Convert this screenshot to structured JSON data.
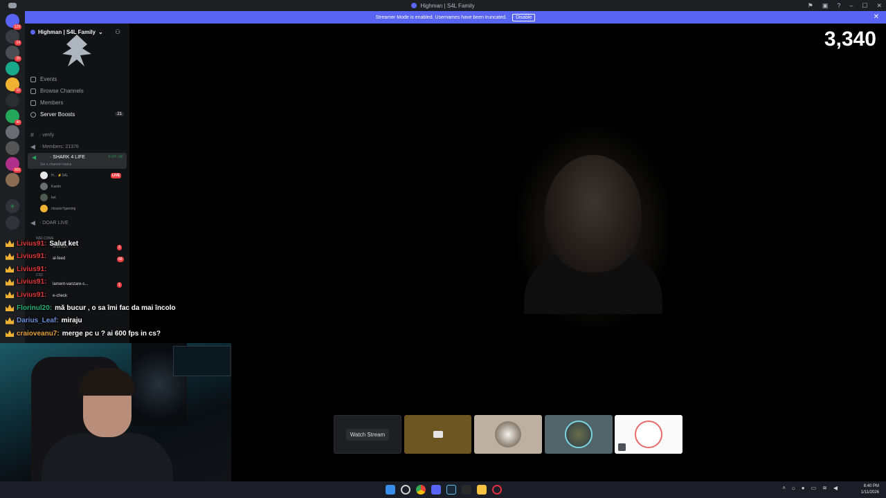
{
  "window": {
    "title": "Highman | S4L Family",
    "controls": [
      "–",
      "☐",
      "✕"
    ]
  },
  "banner": {
    "text": "Streamer Mode is enabled. Usernames have been truncated.",
    "disable_label": "Disable",
    "close_label": "✕"
  },
  "rail": {
    "servers": [
      {
        "name": "home",
        "color": "#5865f2",
        "badge": "129"
      },
      {
        "name": "server-1",
        "color": "#3a3c42",
        "badge": "14"
      },
      {
        "name": "server-2",
        "color": "#4a4d52",
        "badge": "26"
      },
      {
        "name": "server-3",
        "color": "#1aa88a",
        "badge": ""
      },
      {
        "name": "server-4",
        "color": "#f0b232",
        "badge": "10"
      },
      {
        "name": "server-5",
        "color": "#2b2d31",
        "badge": ""
      },
      {
        "name": "server-6",
        "color": "#23a55a",
        "badge": "40"
      },
      {
        "name": "server-7",
        "color": "#6a6d72",
        "badge": ""
      },
      {
        "name": "server-8",
        "color": "#555",
        "badge": ""
      },
      {
        "name": "server-9",
        "color": "#b02f8a",
        "badge": "365"
      },
      {
        "name": "server-10",
        "color": "#8a6d52",
        "badge": ""
      }
    ]
  },
  "sidebar": {
    "server_name": "Highman | S4L Family",
    "nav": [
      {
        "label": "Events",
        "count": ""
      },
      {
        "label": "Browse Channels",
        "count": ""
      },
      {
        "label": "Members",
        "count": ""
      },
      {
        "label": "Server Boosts",
        "count": "21"
      }
    ],
    "channels": [
      {
        "label": "· verify"
      },
      {
        "label": "· Members: 21376"
      }
    ],
    "voice": {
      "name": "· SHARK 4 LIFE",
      "status": "Set a channel status",
      "timer": "3:07:36",
      "live": "LIVE",
      "users": [
        "H... ⚡S4L",
        "Kasim",
        "ket",
        "nicusor7gaming"
      ]
    },
    "doar_live": "· DOAR LIVE",
    "category_welcome": "WELCOME",
    "category_cs2": "CS2",
    "text_channels": [
      {
        "label": "anunturi",
        "badge": "3"
      },
      {
        "label": "al-feed",
        "badge": "68"
      },
      {
        "label": "lament-vanzare-s...",
        "badge": "1"
      },
      {
        "label": "e-check",
        "badge": ""
      }
    ]
  },
  "chat": [
    {
      "user": "Livius91:",
      "msg": "Salut ket",
      "user_color": "#e03a3a"
    },
    {
      "user": "Livius91:",
      "msg": "",
      "user_color": "#e03a3a"
    },
    {
      "user": "Livius91:",
      "msg": "",
      "user_color": "#e03a3a"
    },
    {
      "user": "Livius91:",
      "msg": "",
      "user_color": "#e03a3a"
    },
    {
      "user": "Livius91:",
      "msg": "",
      "user_color": "#e03a3a"
    },
    {
      "user": "Florinul20:",
      "msg": "mă bucur , o sa îmi fac da mai încolo",
      "user_color": "#2ab27b"
    },
    {
      "user": "Darius_Leaf:",
      "msg": "miraju",
      "user_color": "#6a8fd9"
    },
    {
      "user": "craioveanu7:",
      "msg": "merge pc u ? ai 600 fps in cs?",
      "user_color": "#e8a33a"
    }
  ],
  "stream": {
    "viewer_count": "3,340",
    "watch_stream_label": "Watch Stream"
  },
  "taskbar": {
    "time": "8:40 PM",
    "date": "1/11/2026",
    "apps": [
      "windows-start",
      "search",
      "chrome",
      "discord",
      "steam",
      "epic",
      "file-explorer",
      "opera"
    ]
  }
}
